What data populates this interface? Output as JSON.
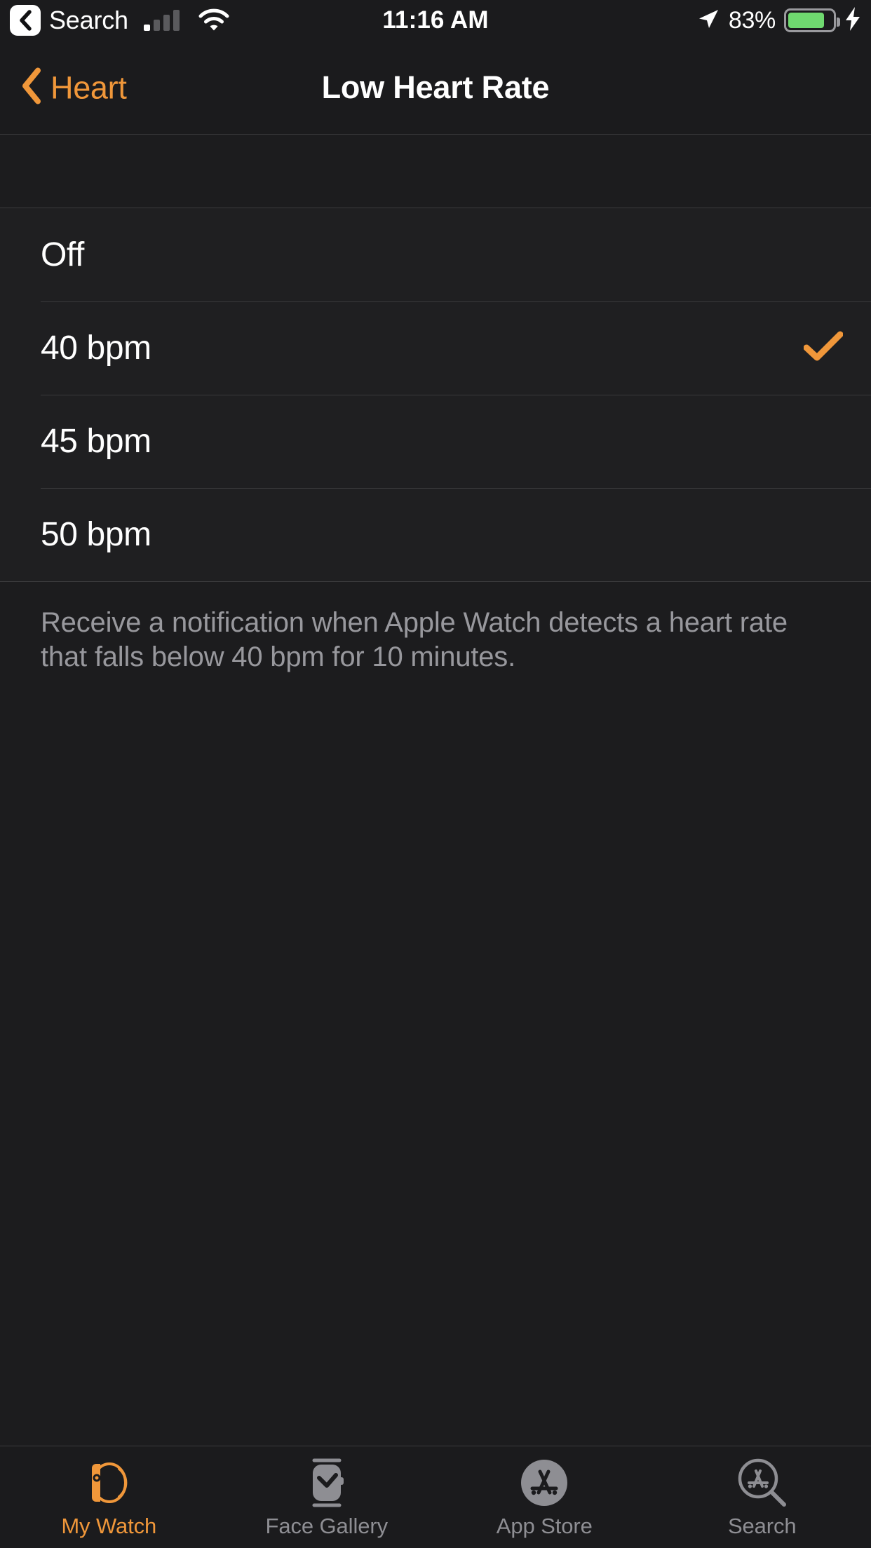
{
  "status_bar": {
    "back_app_label": "Search",
    "back_icon": "chevron-left-icon",
    "signal_icon": "cellular-signal-icon",
    "signal_bars_filled": 1,
    "signal_bars_total": 4,
    "wifi_icon": "wifi-icon",
    "time": "11:16 AM",
    "location_icon": "location-arrow-icon",
    "battery_percent": "83%",
    "battery_level": 83,
    "battery_color": "#6fd96f",
    "charging_icon": "lightning-bolt-icon"
  },
  "nav_bar": {
    "back_label": "Heart",
    "back_icon": "chevron-left-icon",
    "title": "Low Heart Rate",
    "accent_color": "#f0973a"
  },
  "options": {
    "items": [
      {
        "label": "Off",
        "selected": false
      },
      {
        "label": "40 bpm",
        "selected": true
      },
      {
        "label": "45 bpm",
        "selected": false
      },
      {
        "label": "50 bpm",
        "selected": false
      }
    ],
    "check_icon": "checkmark-icon"
  },
  "footer": {
    "note": "Receive a notification when Apple Watch detects a heart rate that falls below 40 bpm for 10 minutes."
  },
  "tab_bar": {
    "tabs": [
      {
        "label": "My Watch",
        "icon": "apple-watch-outline-icon",
        "active": true
      },
      {
        "label": "Face Gallery",
        "icon": "watch-face-icon",
        "active": false
      },
      {
        "label": "App Store",
        "icon": "app-store-icon",
        "active": false
      },
      {
        "label": "Search",
        "icon": "app-store-search-icon",
        "active": false
      }
    ],
    "active_color": "#f0973a",
    "inactive_color": "#8e8e93"
  }
}
